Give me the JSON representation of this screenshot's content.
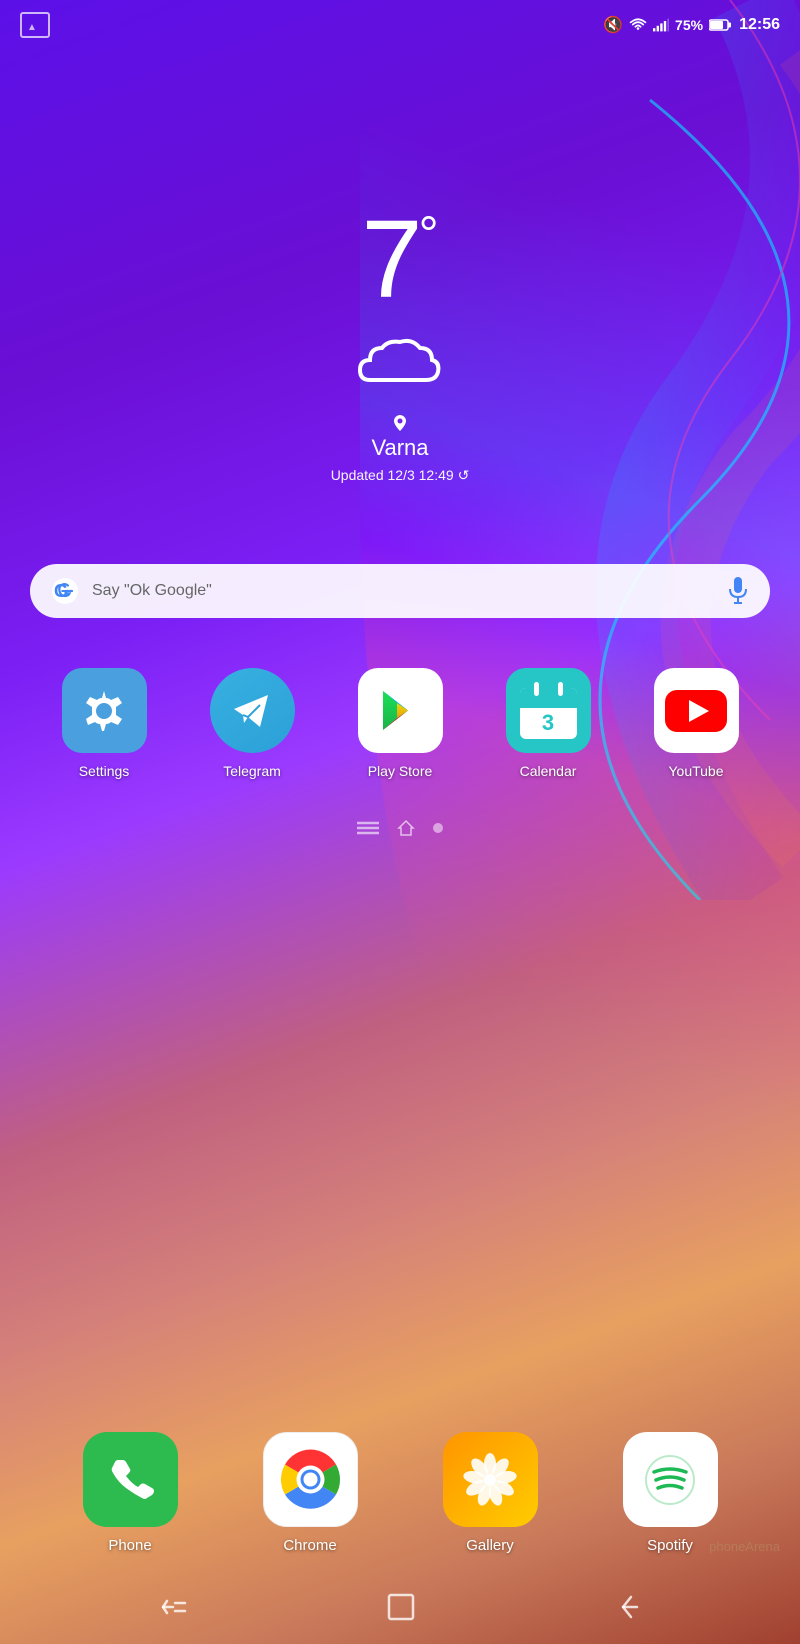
{
  "statusBar": {
    "time": "12:56",
    "battery": "75%",
    "notification_icon": "🖼",
    "mute_icon": "🔇",
    "wifi_icon": "WiFi",
    "signal_icon": "Signal"
  },
  "weather": {
    "temperature": "7",
    "degree": "°",
    "city": "Varna",
    "updated": "Updated 12/3 12:49 ↺"
  },
  "search": {
    "placeholder": "Say \"Ok Google\""
  },
  "apps": [
    {
      "id": "settings",
      "label": "Settings"
    },
    {
      "id": "telegram",
      "label": "Telegram"
    },
    {
      "id": "playstore",
      "label": "Play Store"
    },
    {
      "id": "calendar",
      "label": "Calendar"
    },
    {
      "id": "youtube",
      "label": "YouTube"
    }
  ],
  "dock": [
    {
      "id": "phone",
      "label": "Phone"
    },
    {
      "id": "chrome",
      "label": "Chrome"
    },
    {
      "id": "gallery",
      "label": "Gallery"
    },
    {
      "id": "spotify",
      "label": "Spotify"
    }
  ],
  "navigation": {
    "back_label": "⏎",
    "home_label": "□",
    "recent_label": "⊟"
  },
  "watermark": "phoneArena"
}
